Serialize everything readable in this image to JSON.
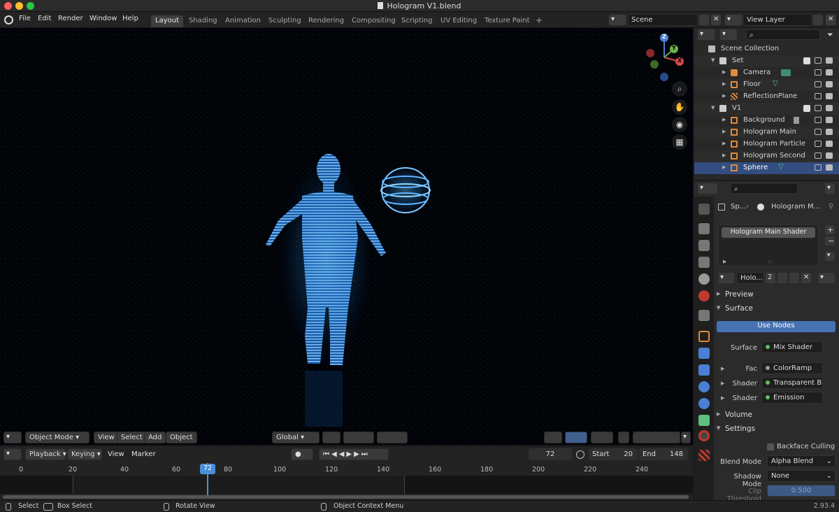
{
  "window": {
    "title": "Hologram V1.blend"
  },
  "menu": [
    "File",
    "Edit",
    "Render",
    "Window",
    "Help"
  ],
  "workspaces": [
    "Layout",
    "Shading",
    "Animation",
    "Sculpting",
    "Rendering",
    "Compositing",
    "Scripting",
    "UV Editing",
    "Texture Paint"
  ],
  "active_workspace": "Layout",
  "scene": {
    "label": "Scene",
    "view_layer": "View Layer"
  },
  "viewport_header": {
    "mode": "Object Mode",
    "menus": [
      "View",
      "Select",
      "Add",
      "Object"
    ],
    "orientation": "Global"
  },
  "gizmo": {
    "z": "Z",
    "y": "Y",
    "x": "X"
  },
  "timeline": {
    "menus": [
      "Playback",
      "Keying",
      "View",
      "Marker"
    ],
    "current_frame": "72",
    "start_label": "Start",
    "start": "20",
    "end_label": "End",
    "end": "148",
    "ticks": [
      "0",
      "20",
      "40",
      "60",
      "80",
      "100",
      "120",
      "140",
      "160",
      "180",
      "200",
      "220",
      "240"
    ]
  },
  "status": {
    "select": "Select",
    "box_select": "Box Select",
    "rotate": "Rotate View",
    "context_menu": "Object Context Menu",
    "version": "2.93.4"
  },
  "outliner": {
    "root": "Scene Collection",
    "rows": [
      {
        "label": "Set",
        "type": "collection"
      },
      {
        "label": "Camera",
        "type": "camera"
      },
      {
        "label": "Floor",
        "type": "mesh"
      },
      {
        "label": "ReflectionPlane",
        "type": "plane"
      },
      {
        "label": "V1",
        "type": "collection"
      },
      {
        "label": "Background",
        "type": "mesh"
      },
      {
        "label": "Hologram Main",
        "type": "mesh"
      },
      {
        "label": "Hologram Particle",
        "type": "mesh"
      },
      {
        "label": "Hologram Second",
        "type": "mesh"
      },
      {
        "label": "Sphere",
        "type": "mesh"
      }
    ]
  },
  "properties": {
    "object_short": "Sp...",
    "material_short": "Hologram M...",
    "slot": "Hologram Main Shader",
    "material_name": "Holo...",
    "users": "2",
    "sections": {
      "preview": "Preview",
      "surface": "Surface",
      "volume": "Volume",
      "settings": "Settings"
    },
    "use_nodes": "Use Nodes",
    "surface_label": "Surface",
    "surface_value": "Mix Shader",
    "fac_label": "Fac",
    "fac_value": "ColorRamp",
    "shader1_label": "Shader",
    "shader1_value": "Transparent B...",
    "shader2_label": "Shader",
    "shader2_value": "Emission",
    "backface": "Backface Culling",
    "blend_label": "Blend Mode",
    "blend_value": "Alpha Blend",
    "shadow_label": "Shadow Mode",
    "shadow_value": "None",
    "clip_label": "Clip Threshold",
    "clip_value": "0.500"
  }
}
